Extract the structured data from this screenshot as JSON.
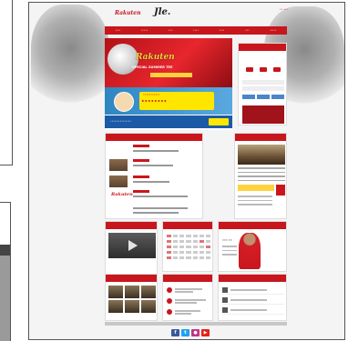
{
  "header": {
    "logo_text": "Rakuten",
    "logo_script": "Jle.",
    "links": "••• •••"
  },
  "nav": {
    "items": [
      "••••",
      "•••••",
      "•••",
      "••••",
      "••••",
      "•••",
      "•••••"
    ]
  },
  "banner": {
    "title": "Rakuten",
    "sub": "SPECIAL SUMMER TEE",
    "mid_text1": "•••••••••••",
    "mid_text2": "••••••••",
    "foot_text": "•••••••••••••••"
  },
  "social": {
    "fb": "f",
    "tw": "t",
    "ig": "●",
    "yt": "▶"
  },
  "player": {
    "name": "••• ••"
  },
  "colors": {
    "brand_red": "#c8161d",
    "banner_blue": "#1c5aa6",
    "banner_yellow": "#ffd23f"
  }
}
